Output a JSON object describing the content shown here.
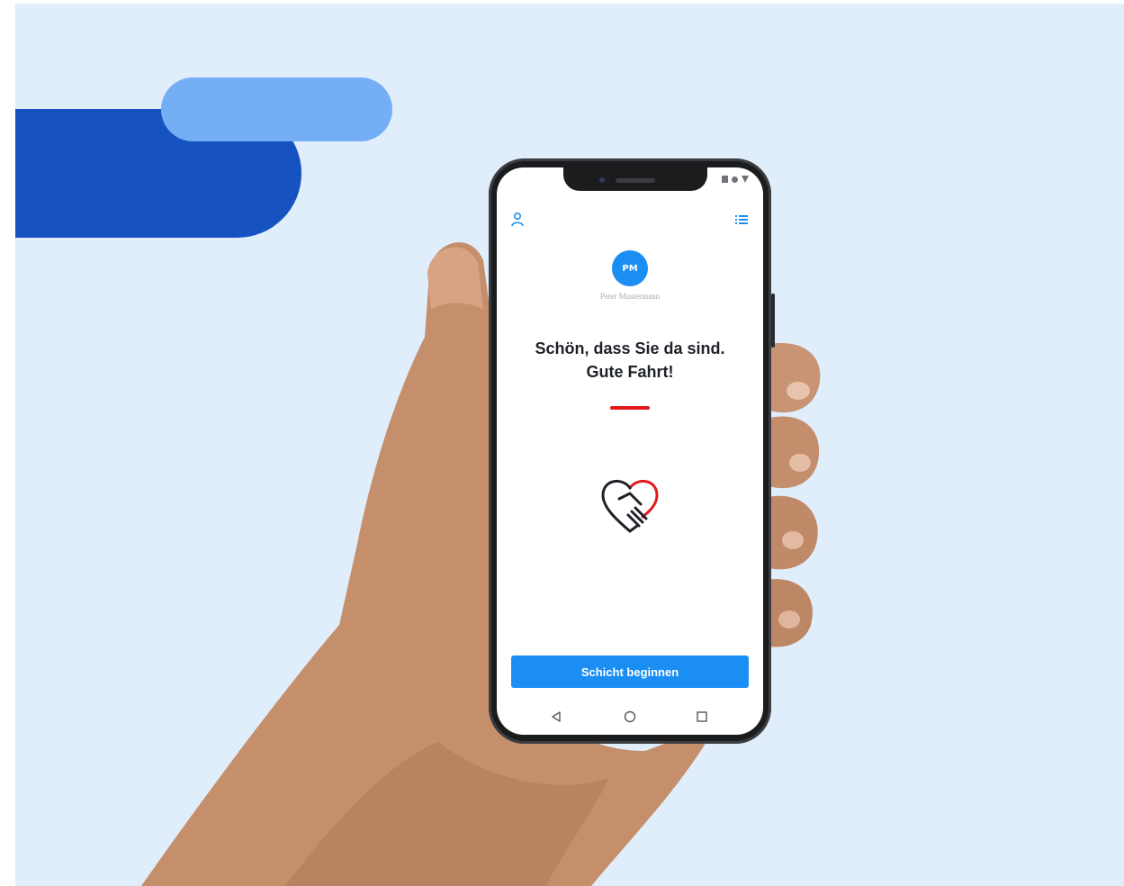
{
  "app": {
    "header": {
      "profile_icon": "user-icon",
      "menu_icon": "list-icon"
    },
    "user": {
      "initials": "PM",
      "name": "Peter Mustermann"
    },
    "welcome": {
      "line1": "Schön, dass Sie da sind.",
      "line2": "Gute Fahrt!"
    },
    "illustration_icon": "handshake-heart-icon",
    "primary_button": {
      "label": "Schicht beginnen"
    },
    "nav_bar": {
      "back_icon": "triangle-back-icon",
      "home_icon": "circle-home-icon",
      "recents_icon": "square-recents-icon"
    }
  },
  "colors": {
    "background": "#e0edfb",
    "brand_dark_blue": "#1752c1",
    "brand_light_blue": "#74aef4",
    "accent_blue": "#1a8ef2",
    "accent_red": "#e3191c",
    "text_dark": "#1e2228"
  }
}
